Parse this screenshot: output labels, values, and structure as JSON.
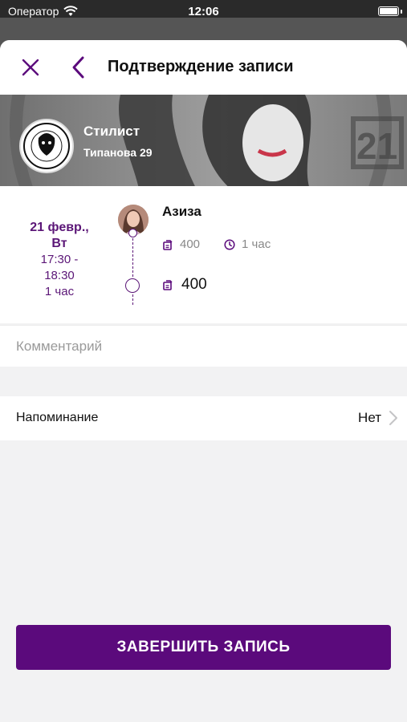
{
  "status_bar": {
    "carrier": "Оператор",
    "time": "12:06"
  },
  "nav": {
    "title": "Подтверждение записи",
    "close_icon": "close-icon",
    "back_icon": "chevron-left-icon"
  },
  "salon": {
    "name": "Стилист",
    "address": "Типанова 29",
    "logo_year": "21"
  },
  "booking": {
    "date": "21 февр.,",
    "weekday": "Вт",
    "time_range_start": "17:30 -",
    "time_range_end": "18:30",
    "duration_left": "1 час",
    "master_name": "Азиза",
    "service_price": "400",
    "service_duration": "1 час",
    "total_price": "400"
  },
  "comment": {
    "placeholder": "Комментарий"
  },
  "reminder": {
    "label": "Напоминание",
    "value": "Нет"
  },
  "actions": {
    "finish_label": "ЗАВЕРШИТЬ ЗАПИСЬ"
  },
  "colors": {
    "accent": "#5b0a7c",
    "accent_text": "#5b1677",
    "background": "#f2f2f3"
  }
}
